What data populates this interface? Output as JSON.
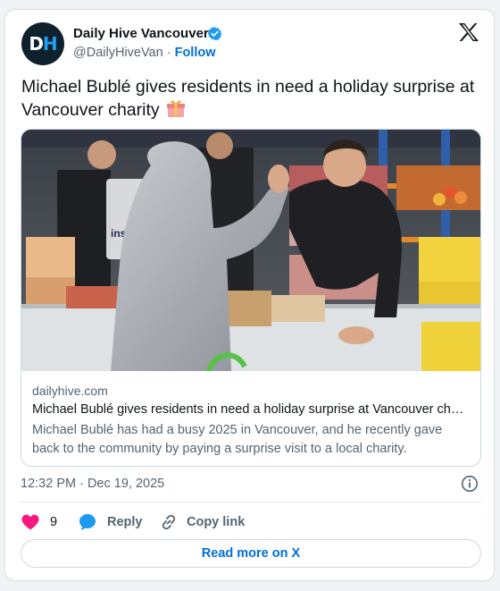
{
  "author": {
    "display_name": "Daily Hive Vancouver",
    "handle": "@DailyHiveVan",
    "separator": "·",
    "follow_label": "Follow",
    "avatar_letters": {
      "first": "D",
      "second": "H"
    },
    "verified_icon": "verified-badge-icon"
  },
  "tweet": {
    "text": "Michael Bublé gives residents in need a holiday surprise at Vancouver charity",
    "emoji_icon": "gift-icon"
  },
  "link_card": {
    "domain": "dailyhive.com",
    "title": "Michael Bublé gives residents in need a holiday surprise at Vancouver charity",
    "description": "Michael Bublé has had a busy 2025 in Vancouver, and he recently gave back to the community by paying a surprise visit to a local charity.",
    "photo_icon": "charity-photo",
    "photo_bag_text": "inspir"
  },
  "meta": {
    "timestamp": "12:32 PM · Dec 19, 2025"
  },
  "actions": {
    "like_count": "9",
    "reply_label": "Reply",
    "copy_link_label": "Copy link",
    "read_more_label": "Read more on X"
  },
  "colors": {
    "accent": "#006fd6",
    "like": "#f91880",
    "reply": "#1d9bf0",
    "verified": "#1d9bf0",
    "text_primary": "#0f1419",
    "text_secondary": "#536471"
  }
}
